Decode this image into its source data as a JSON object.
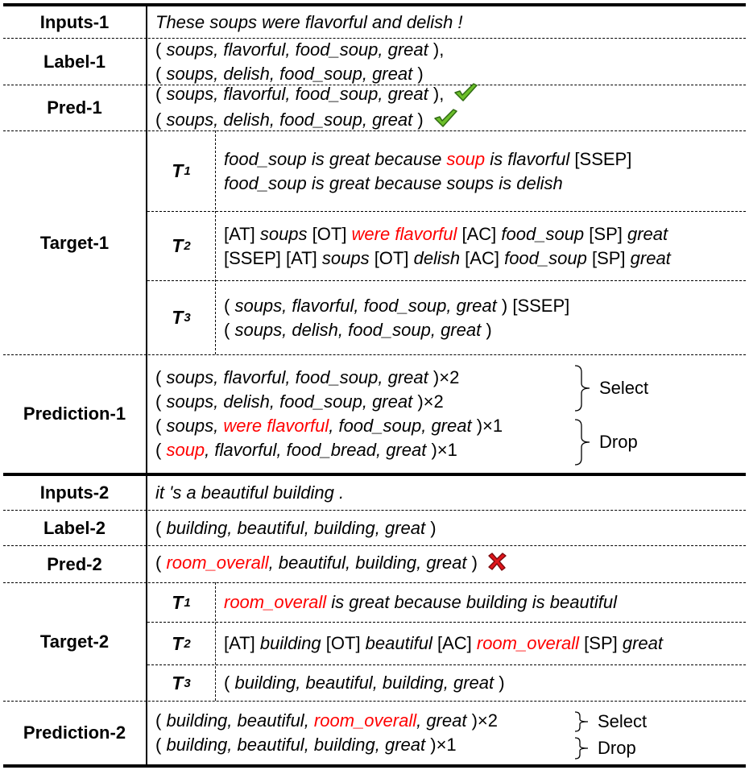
{
  "colors": {
    "highlight": "#ff0000",
    "check": "#6cbf2a",
    "cross": "#e0151b"
  },
  "rows": {
    "inputs1": {
      "label": "Inputs-1",
      "text": "These soups were flavorful and delish !"
    },
    "label1": {
      "label": "Label-1",
      "lines": [
        {
          "open": "( ",
          "a": "soups, flavorful, food_soup, great",
          "close": " ),"
        },
        {
          "open": "( ",
          "a": "soups, delish, food_soup, great",
          "close": " )"
        }
      ]
    },
    "pred1": {
      "label": "Pred-1",
      "lines": [
        {
          "open": "( ",
          "a": "soups, flavorful, food_soup, great",
          "close": " ),",
          "status": "check-icon"
        },
        {
          "open": "( ",
          "a": "soups, delish, food_soup, great",
          "close": " )",
          "status": "check-icon"
        }
      ]
    },
    "target1": {
      "label": "Target-1",
      "t": [
        {
          "name": "T",
          "sub": "1",
          "line1": {
            "a": "food_soup is great because ",
            "red": "soup",
            "b": " is flavorful",
            "tag": " [SSEP]"
          },
          "line2": {
            "a": "food_soup is great because soups is delish"
          }
        },
        {
          "name": "T",
          "sub": "2",
          "line1": {
            "at": "[AT] ",
            "asp": "soups",
            "ot": " [OT] ",
            "op": "were flavorful",
            "ac": " [AC] ",
            "cat": "food_soup",
            "sp": " [SP] ",
            "pol": "great"
          },
          "line2": {
            "pre": "[SSEP] [AT] ",
            "asp": "soups",
            "ot": " [OT] ",
            "op": "delish",
            "ac": " [AC] ",
            "cat": "food_soup",
            "sp": " [SP] ",
            "pol": "great"
          }
        },
        {
          "name": "T",
          "sub": "3",
          "line1": {
            "open": "( ",
            "a": "soups, flavorful, food_soup, great",
            "close": " ) [SSEP]"
          },
          "line2": {
            "open": "( ",
            "a": "soups, delish, food_soup, great",
            "close": " )"
          }
        }
      ]
    },
    "prediction1": {
      "label": "Prediction-1",
      "lines": [
        {
          "open": "( ",
          "a": "soups, flavorful, food_soup, great",
          "close": " )×2"
        },
        {
          "open": "( ",
          "a": "soups, delish, food_soup, great",
          "close": " )×2"
        },
        {
          "open": "( ",
          "a": "soups, ",
          "red": "were flavorful",
          "b": ", food_soup, great",
          "close": " )×1"
        },
        {
          "open": "( ",
          "red": "soup",
          "b": ", flavorful, food_bread, great",
          "close": " )×1"
        }
      ],
      "select_label": "Select",
      "drop_label": "Drop"
    },
    "inputs2": {
      "label": "Inputs-2",
      "text": "it 's a beautiful building ."
    },
    "label2": {
      "label": "Label-2",
      "open": "( ",
      "a": "building, beautiful, building, great",
      "close": " )"
    },
    "pred2": {
      "label": "Pred-2",
      "open": "( ",
      "red": "room_overall",
      "b": ", beautiful, building, great",
      "close": " )",
      "status": "cross-icon"
    },
    "target2": {
      "label": "Target-2",
      "t": [
        {
          "name": "T",
          "sub": "1",
          "red": "room_overall",
          "b": " is great because building is beautiful"
        },
        {
          "name": "T",
          "sub": "2",
          "at": "[AT] ",
          "asp": "building",
          "ot": " [OT] ",
          "op": "beautiful",
          "ac": " [AC] ",
          "cat": "room_overall",
          "sp": " [SP] ",
          "pol": "great"
        },
        {
          "name": "T",
          "sub": "3",
          "open": "( ",
          "a": "building, beautiful, building, great",
          "close": " )"
        }
      ]
    },
    "prediction2": {
      "label": "Prediction-2",
      "lines": [
        {
          "open": "( ",
          "a": "building, beautiful, ",
          "red": "room_overall",
          "b": ", great",
          "close": " )×2"
        },
        {
          "open": "( ",
          "a": "building, beautiful, building, great",
          "close": " )×1"
        }
      ],
      "select_label": "Select",
      "drop_label": "Drop"
    }
  }
}
